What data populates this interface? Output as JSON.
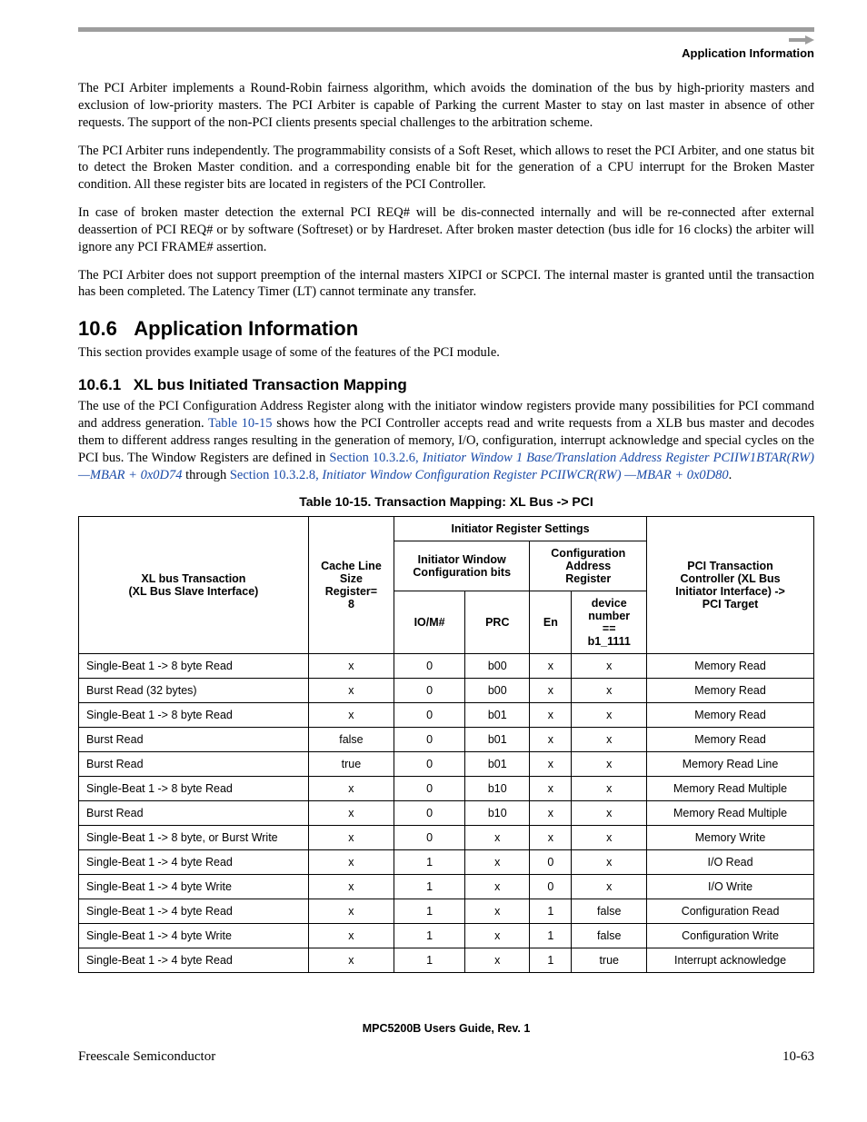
{
  "header": {
    "section_label": "Application Information"
  },
  "paragraphs": {
    "p1": "The PCI Arbiter implements a Round-Robin fairness algorithm, which avoids the domination of the bus by high-priority masters and exclusion of low-priority masters. The PCI Arbiter is capable of Parking the current Master to stay on last master in absence of other requests. The support of the non-PCI clients presents special challenges to the arbitration scheme.",
    "p2": "The PCI Arbiter runs independently. The programmability consists of a Soft Reset, which allows to reset the PCI Arbiter, and one status bit to detect the Broken Master condition. and a corresponding enable bit for the generation of a CPU interrupt for the Broken Master condition. All these register bits are located in registers of the PCI Controller.",
    "p3": "In case of broken master detection the external PCI REQ# will be dis-connected internally and will be re-connected after external deassertion of PCI REQ# or by software (Softreset) or by Hardreset. After broken master detection (bus idle for 16 clocks) the arbiter will ignore any PCI FRAME# assertion.",
    "p4": "The PCI Arbiter does not support preemption of the internal masters XIPCI or SCPCI. The internal master is granted until the transaction has been completed. The Latency Timer (LT) cannot terminate any transfer."
  },
  "h1": {
    "num": "10.6",
    "title": "Application Information"
  },
  "p5": "This section provides example usage of some of the features of the PCI module.",
  "h2": {
    "num": "10.6.1",
    "title": "XL bus Initiated Transaction Mapping"
  },
  "p6a": "The use of the PCI Configuration Address Register along with the initiator window registers provide many possibilities for PCI command and address generation. ",
  "xref_t15": "Table 10-15",
  "p6b": " shows how the PCI Controller accepts read and write requests from a XLB bus master and decodes them to different address ranges resulting in the generation of memory, I/O, configuration, interrupt acknowledge and special cycles on the PCI bus. The Window Registers are defined in ",
  "xref_s26": "Section 10.3.2.6, ",
  "xref_s26i": "Initiator Window 1 Base/Translation Address Register PCIIW1BTAR(RW) —MBAR + 0x0D74",
  "p6c": " through ",
  "xref_s28": "Section 10.3.2.8, ",
  "xref_s28i": "Initiator Window Configuration Register PCIIWCR(RW) —MBAR + 0x0D80",
  "p6d": ".",
  "table": {
    "caption": "Table 10-15. Transaction Mapping: XL Bus -> PCI",
    "head": {
      "col1_line1": "XL bus Transaction",
      "col1_line2": "(XL Bus Slave Interface)",
      "col2_line1": "Cache Line",
      "col2_line2": "Size",
      "col2_line3": "Register=",
      "col2_line4": "8",
      "irs": "Initiator Register Settings",
      "iwc_line1": "Initiator Window",
      "iwc_line2": "Configuration bits",
      "car_line1": "Configuration",
      "car_line2": "Address",
      "car_line3": "Register",
      "col7_line1": "PCI Transaction",
      "col7_line2": "Controller (XL Bus",
      "col7_line3": "Initiator Interface) ->",
      "col7_line4": "PCI Target",
      "iom": "IO/M#",
      "prc": "PRC",
      "en": "En",
      "dev_line1": "device",
      "dev_line2": "number",
      "dev_line3": "==",
      "dev_line4": "b1_1111"
    },
    "rows": [
      {
        "c1": "Single-Beat 1 -> 8 byte Read",
        "c2": "x",
        "c3": "0",
        "c4": "b00",
        "c5": "x",
        "c6": "x",
        "c7": "Memory Read"
      },
      {
        "c1": "Burst Read (32 bytes)",
        "c2": "x",
        "c3": "0",
        "c4": "b00",
        "c5": "x",
        "c6": "x",
        "c7": "Memory Read"
      },
      {
        "c1": "Single-Beat 1 -> 8 byte Read",
        "c2": "x",
        "c3": "0",
        "c4": "b01",
        "c5": "x",
        "c6": "x",
        "c7": "Memory Read"
      },
      {
        "c1": "Burst Read",
        "c2": "false",
        "c3": "0",
        "c4": "b01",
        "c5": "x",
        "c6": "x",
        "c7": "Memory Read"
      },
      {
        "c1": "Burst Read",
        "c2": "true",
        "c3": "0",
        "c4": "b01",
        "c5": "x",
        "c6": "x",
        "c7": "Memory Read Line"
      },
      {
        "c1": "Single-Beat 1 -> 8 byte Read",
        "c2": "x",
        "c3": "0",
        "c4": "b10",
        "c5": "x",
        "c6": "x",
        "c7": "Memory Read Multiple"
      },
      {
        "c1": "Burst Read",
        "c2": "x",
        "c3": "0",
        "c4": "b10",
        "c5": "x",
        "c6": "x",
        "c7": "Memory Read Multiple"
      },
      {
        "c1": "Single-Beat 1 -> 8 byte, or Burst Write",
        "c2": "x",
        "c3": "0",
        "c4": "x",
        "c5": "x",
        "c6": "x",
        "c7": "Memory Write"
      },
      {
        "c1": "Single-Beat 1 -> 4 byte Read",
        "c2": "x",
        "c3": "1",
        "c4": "x",
        "c5": "0",
        "c6": "x",
        "c7": "I/O Read"
      },
      {
        "c1": "Single-Beat 1 -> 4 byte Write",
        "c2": "x",
        "c3": "1",
        "c4": "x",
        "c5": "0",
        "c6": "x",
        "c7": "I/O Write"
      },
      {
        "c1": "Single-Beat 1 -> 4 byte Read",
        "c2": "x",
        "c3": "1",
        "c4": "x",
        "c5": "1",
        "c6": "false",
        "c7": "Configuration Read"
      },
      {
        "c1": "Single-Beat 1 -> 4 byte Write",
        "c2": "x",
        "c3": "1",
        "c4": "x",
        "c5": "1",
        "c6": "false",
        "c7": "Configuration Write"
      },
      {
        "c1": "Single-Beat 1 -> 4 byte Read",
        "c2": "x",
        "c3": "1",
        "c4": "x",
        "c5": "1",
        "c6": "true",
        "c7": "Interrupt acknowledge"
      }
    ]
  },
  "footer": {
    "guide": "MPC5200B Users Guide, Rev. 1",
    "left": "Freescale Semiconductor",
    "right": "10-63"
  }
}
